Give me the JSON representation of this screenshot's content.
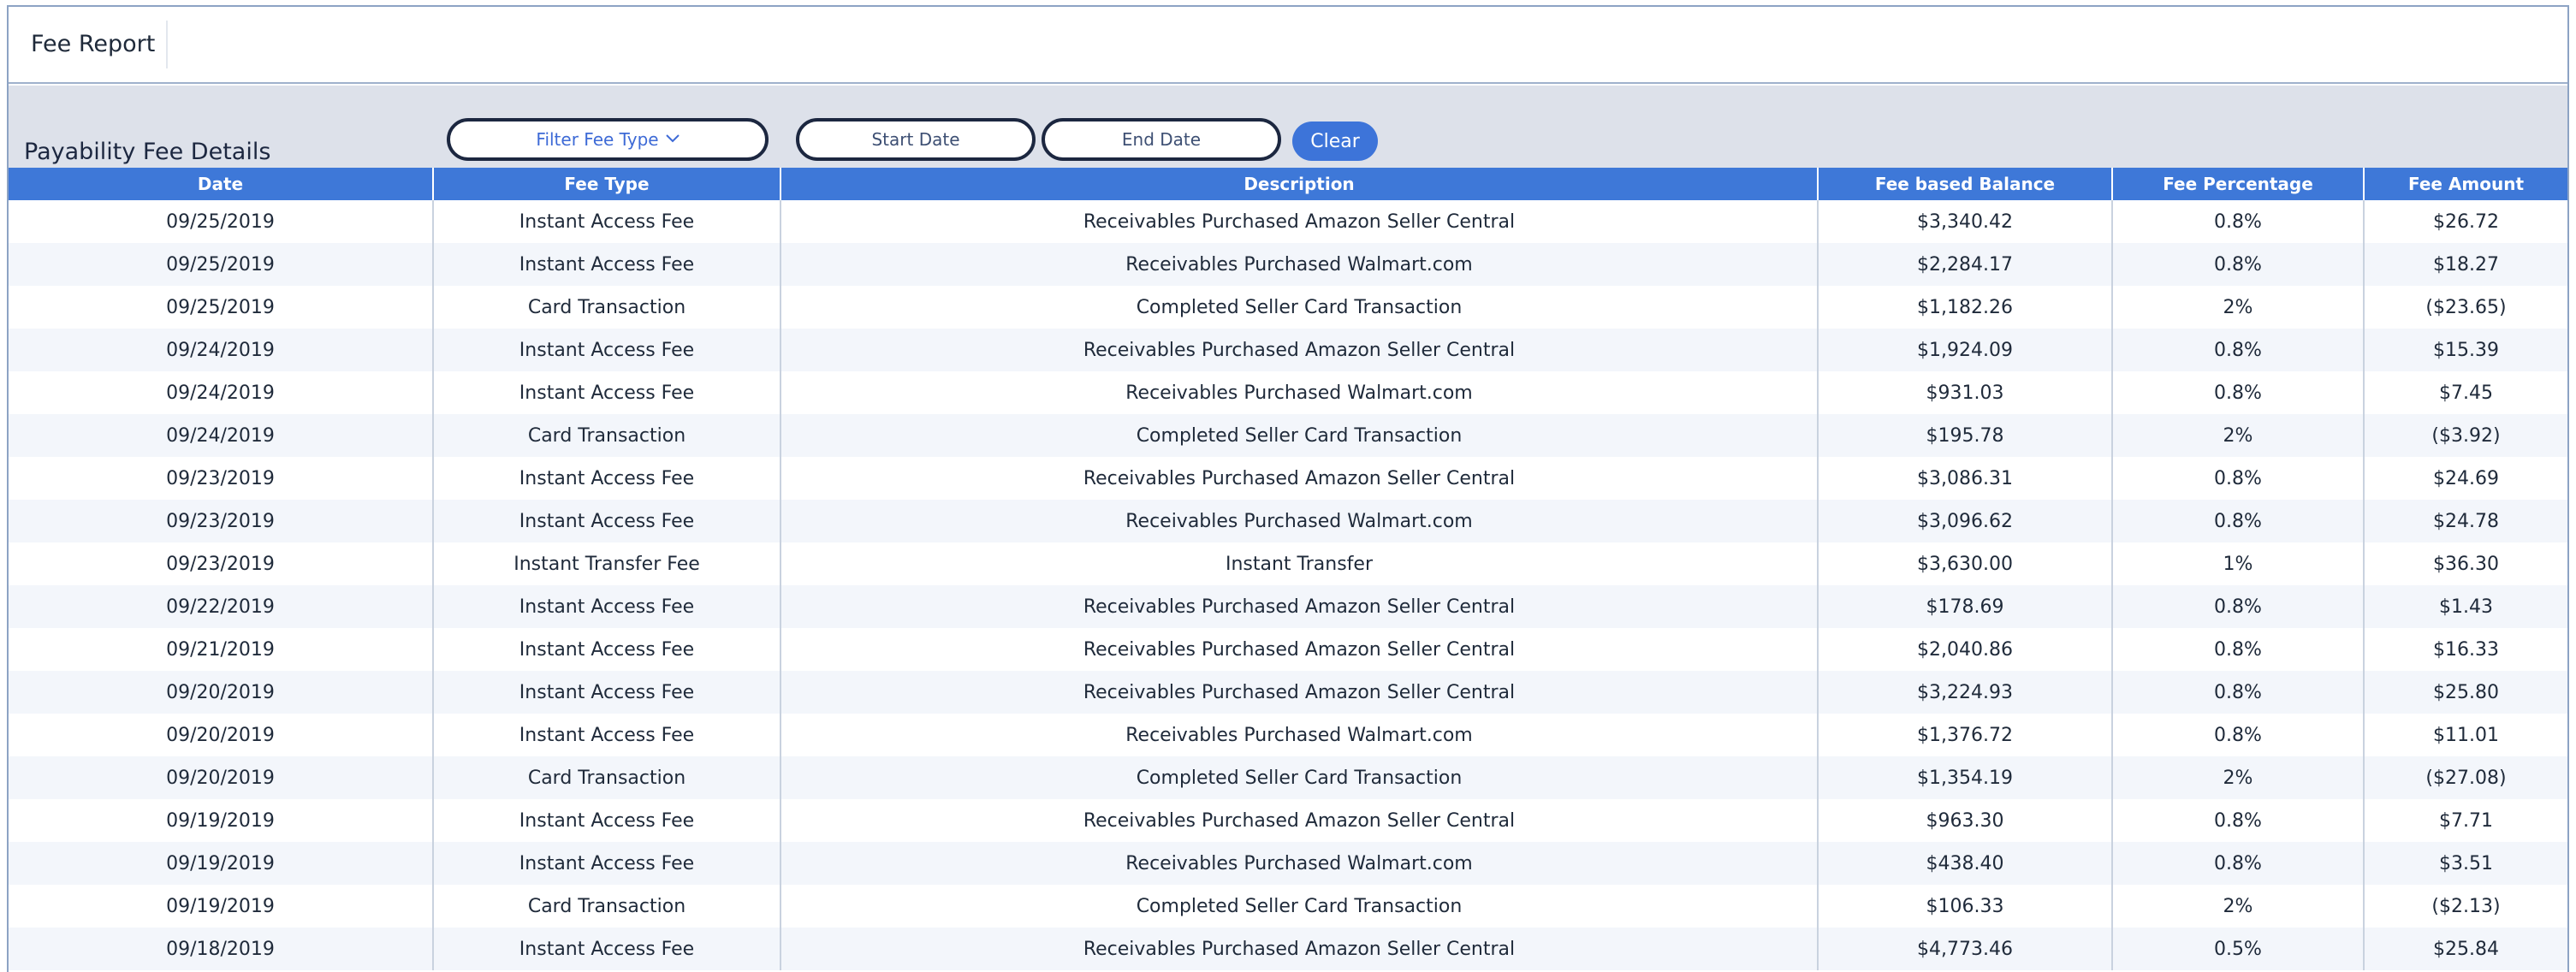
{
  "header": {
    "title": "Fee Report"
  },
  "section": {
    "title": "Payability Fee Details"
  },
  "filters": {
    "fee_type_label": "Filter Fee Type",
    "start_date_placeholder": "Start Date",
    "end_date_placeholder": "End Date",
    "clear_label": "Clear"
  },
  "table": {
    "columns": [
      "Date",
      "Fee Type",
      "Description",
      "Fee based Balance",
      "Fee Percentage",
      "Fee Amount"
    ],
    "rows": [
      [
        "09/25/2019",
        "Instant Access Fee",
        "Receivables Purchased Amazon Seller Central",
        "$3,340.42",
        "0.8%",
        "$26.72"
      ],
      [
        "09/25/2019",
        "Instant Access Fee",
        "Receivables Purchased Walmart.com",
        "$2,284.17",
        "0.8%",
        "$18.27"
      ],
      [
        "09/25/2019",
        "Card Transaction",
        "Completed Seller Card Transaction",
        "$1,182.26",
        "2%",
        "($23.65)"
      ],
      [
        "09/24/2019",
        "Instant Access Fee",
        "Receivables Purchased Amazon Seller Central",
        "$1,924.09",
        "0.8%",
        "$15.39"
      ],
      [
        "09/24/2019",
        "Instant Access Fee",
        "Receivables Purchased Walmart.com",
        "$931.03",
        "0.8%",
        "$7.45"
      ],
      [
        "09/24/2019",
        "Card Transaction",
        "Completed Seller Card Transaction",
        "$195.78",
        "2%",
        "($3.92)"
      ],
      [
        "09/23/2019",
        "Instant Access Fee",
        "Receivables Purchased Amazon Seller Central",
        "$3,086.31",
        "0.8%",
        "$24.69"
      ],
      [
        "09/23/2019",
        "Instant Access Fee",
        "Receivables Purchased Walmart.com",
        "$3,096.62",
        "0.8%",
        "$24.78"
      ],
      [
        "09/23/2019",
        "Instant Transfer Fee",
        "Instant Transfer",
        "$3,630.00",
        "1%",
        "$36.30"
      ],
      [
        "09/22/2019",
        "Instant Access Fee",
        "Receivables Purchased Amazon Seller Central",
        "$178.69",
        "0.8%",
        "$1.43"
      ],
      [
        "09/21/2019",
        "Instant Access Fee",
        "Receivables Purchased Amazon Seller Central",
        "$2,040.86",
        "0.8%",
        "$16.33"
      ],
      [
        "09/20/2019",
        "Instant Access Fee",
        "Receivables Purchased Amazon Seller Central",
        "$3,224.93",
        "0.8%",
        "$25.80"
      ],
      [
        "09/20/2019",
        "Instant Access Fee",
        "Receivables Purchased Walmart.com",
        "$1,376.72",
        "0.8%",
        "$11.01"
      ],
      [
        "09/20/2019",
        "Card Transaction",
        "Completed Seller Card Transaction",
        "$1,354.19",
        "2%",
        "($27.08)"
      ],
      [
        "09/19/2019",
        "Instant Access Fee",
        "Receivables Purchased Amazon Seller Central",
        "$963.30",
        "0.8%",
        "$7.71"
      ],
      [
        "09/19/2019",
        "Instant Access Fee",
        "Receivables Purchased Walmart.com",
        "$438.40",
        "0.8%",
        "$3.51"
      ],
      [
        "09/19/2019",
        "Card Transaction",
        "Completed Seller Card Transaction",
        "$106.33",
        "2%",
        "($2.13)"
      ],
      [
        "09/18/2019",
        "Instant Access Fee",
        "Receivables Purchased Amazon Seller Central",
        "$4,773.46",
        "0.5%",
        "$25.84"
      ]
    ]
  },
  "colors": {
    "header_blue": "#3e78d8",
    "toolbar_bg": "#dde1ea",
    "stripe": "#f3f6fb"
  },
  "icons": {
    "filter_chevron": "chevron-down-icon"
  }
}
